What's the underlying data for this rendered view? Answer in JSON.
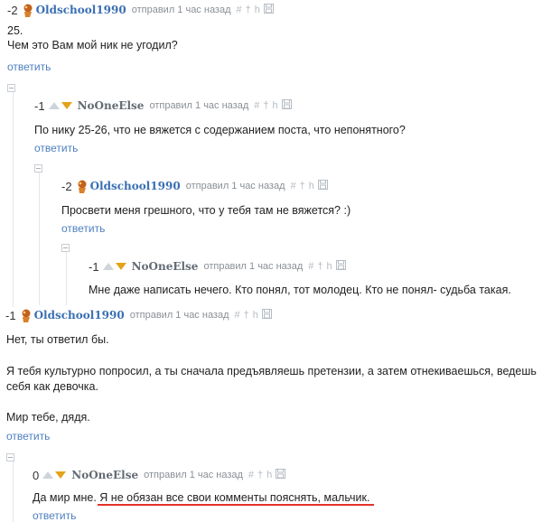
{
  "comments": [
    {
      "score": "-2",
      "author": "Oldschool1990",
      "meta": "отправил 1 час назад",
      "lines": [
        "25.",
        "Чем это Вам мой ник не угодил?"
      ],
      "reply": "ответить"
    },
    {
      "score": "-1",
      "author": "NoOneElse",
      "meta": "отправил 1 час назад",
      "lines": [
        "По нику 25-26, что не вяжется с содержанием поста, что непонятного?"
      ],
      "reply": "ответить"
    },
    {
      "score": "-2",
      "author": "Oldschool1990",
      "meta": "отправил 1 час назад",
      "lines": [
        "Просвети меня грешного, что у тебя там не вяжется? :)"
      ],
      "reply": "ответить"
    },
    {
      "score": "-1",
      "author": "NoOneElse",
      "meta": "отправил 1 час назад",
      "lines": [
        "Мне даже написать нечего. Кто понял, тот молодец. Кто не понял- судьба такая."
      ]
    },
    {
      "score": "-1",
      "author": "Oldschool1990",
      "meta": "отправил 1 час назад",
      "lines": [
        "Нет, ты ответил бы.",
        "Я тебя культурно попросил, а ты сначала предъявляешь претензии, а затем отнекиваешься, ведешь",
        "себя как девочка.",
        "Мир тебе, дядя."
      ],
      "reply": "ответить"
    },
    {
      "score": "0",
      "author": "NoOneElse",
      "meta": "отправил 1 час назад",
      "lines": [
        "Да мир мне. Я не обязан все свои комменты пояснять, мальчик."
      ],
      "reply": "ответить"
    }
  ],
  "icons": {
    "hash": "#",
    "dagger": "†",
    "hook": "h",
    "save": "floppy-disk-icon"
  },
  "colors": {
    "author_blue": "#3a6fb3",
    "author_gray": "#626a73",
    "link": "#4d7fbf",
    "downvote": "#e3a318",
    "highlight": "#e5332a"
  }
}
